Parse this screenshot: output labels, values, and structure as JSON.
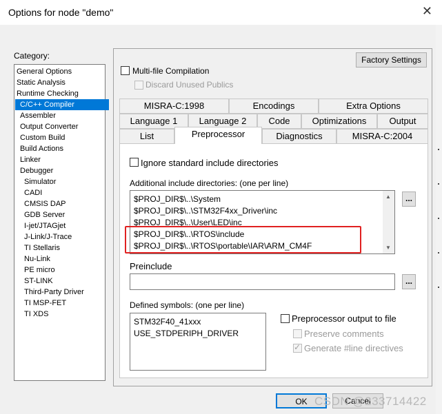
{
  "window": {
    "title": "Options for node \"demo\""
  },
  "category": {
    "label": "Category:",
    "items": [
      {
        "label": "General Options",
        "level": 0
      },
      {
        "label": "Static Analysis",
        "level": 0
      },
      {
        "label": "Runtime Checking",
        "level": 0
      },
      {
        "label": "C/C++ Compiler",
        "level": 1,
        "selected": true
      },
      {
        "label": "Assembler",
        "level": 1
      },
      {
        "label": "Output Converter",
        "level": 1
      },
      {
        "label": "Custom Build",
        "level": 1
      },
      {
        "label": "Build Actions",
        "level": 1
      },
      {
        "label": "Linker",
        "level": 1
      },
      {
        "label": "Debugger",
        "level": 1
      },
      {
        "label": "Simulator",
        "level": 2
      },
      {
        "label": "CADI",
        "level": 2
      },
      {
        "label": "CMSIS DAP",
        "level": 2
      },
      {
        "label": "GDB Server",
        "level": 2
      },
      {
        "label": "I-jet/JTAGjet",
        "level": 2
      },
      {
        "label": "J-Link/J-Trace",
        "level": 2
      },
      {
        "label": "TI Stellaris",
        "level": 2
      },
      {
        "label": "Nu-Link",
        "level": 2
      },
      {
        "label": "PE micro",
        "level": 2
      },
      {
        "label": "ST-LINK",
        "level": 2
      },
      {
        "label": "Third-Party Driver",
        "level": 2
      },
      {
        "label": "TI MSP-FET",
        "level": 2
      },
      {
        "label": "TI XDS",
        "level": 2
      }
    ]
  },
  "options": {
    "factory_settings": "Factory Settings",
    "multifile": "Multi-file Compilation",
    "discard": "Discard Unused Publics"
  },
  "tabs": {
    "row1": [
      "MISRA-C:1998",
      "Encodings",
      "Extra Options"
    ],
    "row2": [
      "Language 1",
      "Language 2",
      "Code",
      "Optimizations",
      "Output"
    ],
    "row3": [
      "List",
      "Preprocessor",
      "Diagnostics",
      "MISRA-C:2004"
    ],
    "active": "Preprocessor"
  },
  "preprocessor": {
    "ignore_std": "Ignore standard include directories",
    "include_label": "Additional include directories: (one per line)",
    "include_lines": [
      "$PROJ_DIR$\\..\\System",
      "$PROJ_DIR$\\..\\STM32F4xx_Driver\\inc",
      "$PROJ_DIR$\\..\\User\\LED\\inc",
      "$PROJ_DIR$\\..\\RTOS\\include",
      "$PROJ_DIR$\\..\\RTOS\\portable\\IAR\\ARM_CM4F"
    ],
    "browse": "...",
    "preinclude_label": "Preinclude",
    "preinclude_value": "",
    "defined_label": "Defined symbols: (one per line)",
    "defined_lines": [
      "STM32F40_41xxx",
      "USE_STDPERIPH_DRIVER"
    ],
    "pp_output": "Preprocessor output to file",
    "preserve_comments": "Preserve comments",
    "generate_line": "Generate #line directives"
  },
  "footer": {
    "ok": "OK",
    "cancel": "Cancel"
  },
  "watermark": "CSDN @233714422"
}
